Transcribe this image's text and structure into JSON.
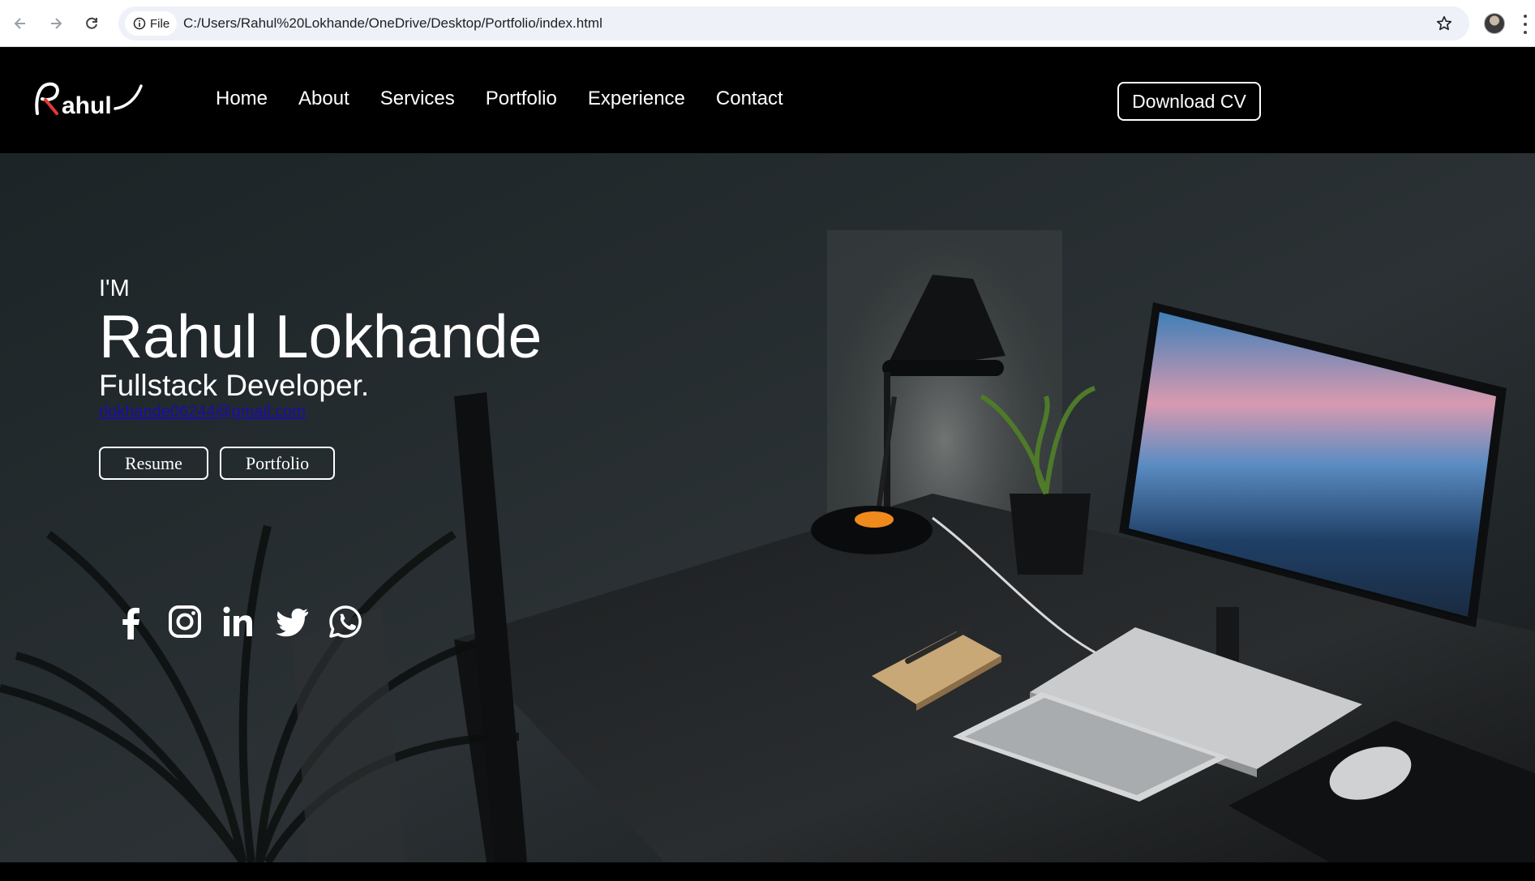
{
  "browser": {
    "site_info_label": "File",
    "url": "C:/Users/Rahul%20Lokhande/OneDrive/Desktop/Portfolio/index.html"
  },
  "header": {
    "logo_text": "Rahul",
    "nav": [
      "Home",
      "About",
      "Services",
      "Portfolio",
      "Experience",
      "Contact"
    ],
    "cv_button": "Download CV"
  },
  "hero": {
    "intro": "I'M",
    "name": "Rahul Lokhande",
    "role": "Fullstack Developer.",
    "email": "rlokhande06244@gmail.com",
    "buttons": [
      "Resume",
      "Portfolio"
    ],
    "socials": [
      "facebook-icon",
      "instagram-icon",
      "linkedin-icon",
      "twitter-icon",
      "whatsapp-icon"
    ]
  },
  "colors": {
    "header_bg": "#000000",
    "text": "#ffffff",
    "email_link": "#1a0dab",
    "accent_orange": "#f08a1c"
  }
}
